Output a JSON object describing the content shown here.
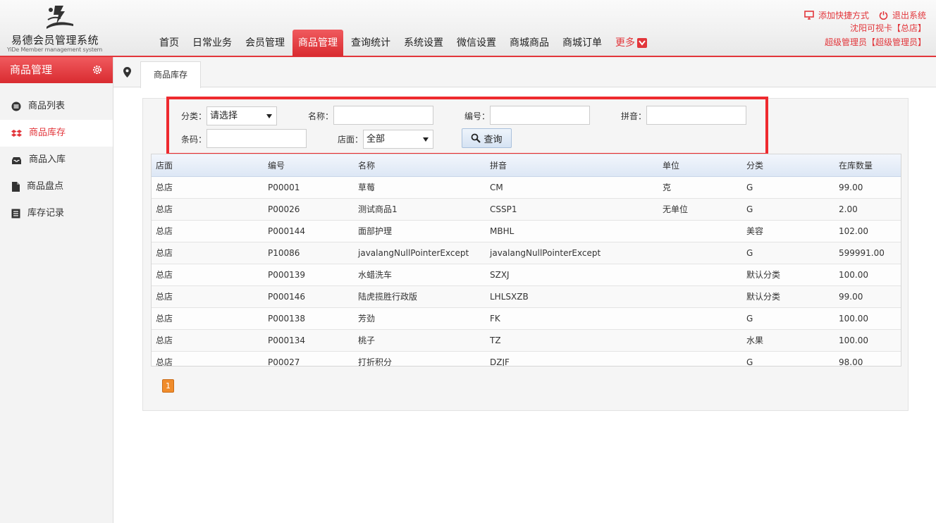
{
  "app": {
    "title": "易德会员管理系统",
    "subtitle": "YiDe Member management system"
  },
  "nav": {
    "items": [
      "首页",
      "日常业务",
      "会员管理",
      "商品管理",
      "查询统计",
      "系统设置",
      "微信设置",
      "商城商品",
      "商城订单"
    ],
    "active_index": 3,
    "more_label": "更多"
  },
  "top_links": {
    "add_shortcut": "添加快捷方式",
    "logout": "退出系统",
    "store_line": "沈阳可视卡【总店】",
    "user_line": "超级管理员【超级管理员】"
  },
  "sidebar": {
    "title": "商品管理",
    "items": [
      {
        "label": "商品列表",
        "icon": "list-circle-icon"
      },
      {
        "label": "商品库存",
        "icon": "dropbox-icon"
      },
      {
        "label": "商品入库",
        "icon": "inbox-icon"
      },
      {
        "label": "商品盘点",
        "icon": "document-icon"
      },
      {
        "label": "库存记录",
        "icon": "record-icon"
      }
    ],
    "active_index": 1
  },
  "tab": {
    "label": "商品库存"
  },
  "filters": {
    "category_label": "分类：",
    "category_value": "请选择",
    "name_label": "名称：",
    "name_value": "",
    "code_label": "编号：",
    "code_value": "",
    "pinyin_label": "拼音：",
    "pinyin_value": "",
    "barcode_label": "条码：",
    "barcode_value": "",
    "store_label": "店面：",
    "store_value": "全部",
    "query_button": "查询"
  },
  "table": {
    "columns": [
      "店面",
      "编号",
      "名称",
      "拼音",
      "单位",
      "分类",
      "在库数量"
    ],
    "rows": [
      [
        "总店",
        "P00001",
        "草莓",
        "CM",
        "克",
        "G",
        "99.00"
      ],
      [
        "总店",
        "P00026",
        "测试商品1",
        "CSSP1",
        "无单位",
        "G",
        "2.00"
      ],
      [
        "总店",
        "P000144",
        "面部护理",
        "MBHL",
        "",
        "美容",
        "102.00"
      ],
      [
        "总店",
        "P10086",
        "javalangNullPointerExcept",
        "javalangNullPointerExcept",
        "",
        "G",
        "599991.00"
      ],
      [
        "总店",
        "P000139",
        "水蜡洗车",
        "SZXJ",
        "",
        "默认分类",
        "100.00"
      ],
      [
        "总店",
        "P000146",
        "陆虎揽胜行政版",
        "LHLSXZB",
        "",
        "默认分类",
        "99.00"
      ],
      [
        "总店",
        "P000138",
        "芳劲",
        "FK",
        "",
        "G",
        "100.00"
      ],
      [
        "总店",
        "P000134",
        "桃子",
        "TZ",
        "",
        "水果",
        "100.00"
      ],
      [
        "总店",
        "P00027",
        "打折积分",
        "DZJF",
        "",
        "G",
        "98.00"
      ]
    ]
  },
  "pager": {
    "current": "1"
  },
  "colors": {
    "accent": "#e2363b",
    "highlight_border": "#ee2a2f",
    "pager": "#f08c2c"
  }
}
